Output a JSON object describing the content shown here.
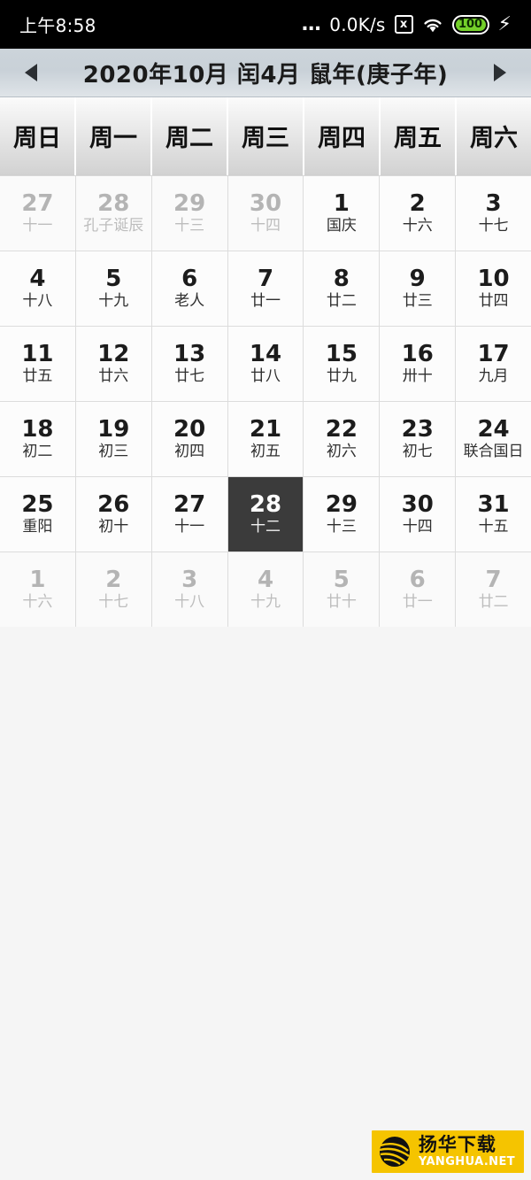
{
  "status_bar": {
    "time": "上午8:58",
    "dots": "...",
    "network_speed": "0.0K/s",
    "nosim_icon": "x",
    "wifi_icon": "wifi-icon",
    "battery_level": "100",
    "charging_icon": "⚡",
    "battery_color": "#74d02a",
    "background": "#000000"
  },
  "title_bar": {
    "prev_label": "◀",
    "next_label": "▶",
    "title": "2020年10月 闰4月 鼠年(庚子年)"
  },
  "weekdays": [
    {
      "label": "周日"
    },
    {
      "label": "周一"
    },
    {
      "label": "周二"
    },
    {
      "label": "周三"
    },
    {
      "label": "周四"
    },
    {
      "label": "周五"
    },
    {
      "label": "周六"
    }
  ],
  "calendar": {
    "selected_day": "28",
    "selected_color": "#3b3b3b",
    "days": [
      {
        "num": "27",
        "lunar": "十一",
        "other": true,
        "selected": false
      },
      {
        "num": "28",
        "lunar": "孔子诞辰",
        "other": true,
        "selected": false
      },
      {
        "num": "29",
        "lunar": "十三",
        "other": true,
        "selected": false
      },
      {
        "num": "30",
        "lunar": "十四",
        "other": true,
        "selected": false
      },
      {
        "num": "1",
        "lunar": "国庆",
        "other": false,
        "selected": false
      },
      {
        "num": "2",
        "lunar": "十六",
        "other": false,
        "selected": false
      },
      {
        "num": "3",
        "lunar": "十七",
        "other": false,
        "selected": false
      },
      {
        "num": "4",
        "lunar": "十八",
        "other": false,
        "selected": false
      },
      {
        "num": "5",
        "lunar": "十九",
        "other": false,
        "selected": false
      },
      {
        "num": "6",
        "lunar": "老人",
        "other": false,
        "selected": false
      },
      {
        "num": "7",
        "lunar": "廿一",
        "other": false,
        "selected": false
      },
      {
        "num": "8",
        "lunar": "廿二",
        "other": false,
        "selected": false
      },
      {
        "num": "9",
        "lunar": "廿三",
        "other": false,
        "selected": false
      },
      {
        "num": "10",
        "lunar": "廿四",
        "other": false,
        "selected": false
      },
      {
        "num": "11",
        "lunar": "廿五",
        "other": false,
        "selected": false
      },
      {
        "num": "12",
        "lunar": "廿六",
        "other": false,
        "selected": false
      },
      {
        "num": "13",
        "lunar": "廿七",
        "other": false,
        "selected": false
      },
      {
        "num": "14",
        "lunar": "廿八",
        "other": false,
        "selected": false
      },
      {
        "num": "15",
        "lunar": "廿九",
        "other": false,
        "selected": false
      },
      {
        "num": "16",
        "lunar": "卅十",
        "other": false,
        "selected": false
      },
      {
        "num": "17",
        "lunar": "九月",
        "other": false,
        "selected": false
      },
      {
        "num": "18",
        "lunar": "初二",
        "other": false,
        "selected": false
      },
      {
        "num": "19",
        "lunar": "初三",
        "other": false,
        "selected": false
      },
      {
        "num": "20",
        "lunar": "初四",
        "other": false,
        "selected": false
      },
      {
        "num": "21",
        "lunar": "初五",
        "other": false,
        "selected": false
      },
      {
        "num": "22",
        "lunar": "初六",
        "other": false,
        "selected": false
      },
      {
        "num": "23",
        "lunar": "初七",
        "other": false,
        "selected": false
      },
      {
        "num": "24",
        "lunar": "联合国日",
        "other": false,
        "selected": false
      },
      {
        "num": "25",
        "lunar": "重阳",
        "other": false,
        "selected": false
      },
      {
        "num": "26",
        "lunar": "初十",
        "other": false,
        "selected": false
      },
      {
        "num": "27",
        "lunar": "十一",
        "other": false,
        "selected": false
      },
      {
        "num": "28",
        "lunar": "十二",
        "other": false,
        "selected": true
      },
      {
        "num": "29",
        "lunar": "十三",
        "other": false,
        "selected": false
      },
      {
        "num": "30",
        "lunar": "十四",
        "other": false,
        "selected": false
      },
      {
        "num": "31",
        "lunar": "十五",
        "other": false,
        "selected": false
      },
      {
        "num": "1",
        "lunar": "十六",
        "other": true,
        "selected": false
      },
      {
        "num": "2",
        "lunar": "十七",
        "other": true,
        "selected": false
      },
      {
        "num": "3",
        "lunar": "十八",
        "other": true,
        "selected": false
      },
      {
        "num": "4",
        "lunar": "十九",
        "other": true,
        "selected": false
      },
      {
        "num": "5",
        "lunar": "廿十",
        "other": true,
        "selected": false
      },
      {
        "num": "6",
        "lunar": "廿一",
        "other": true,
        "selected": false
      },
      {
        "num": "7",
        "lunar": "廿二",
        "other": true,
        "selected": false
      }
    ]
  },
  "watermark": {
    "cn_text": "扬华下载",
    "en_text": "YANGHUA.NET",
    "background": "#f5c400"
  }
}
